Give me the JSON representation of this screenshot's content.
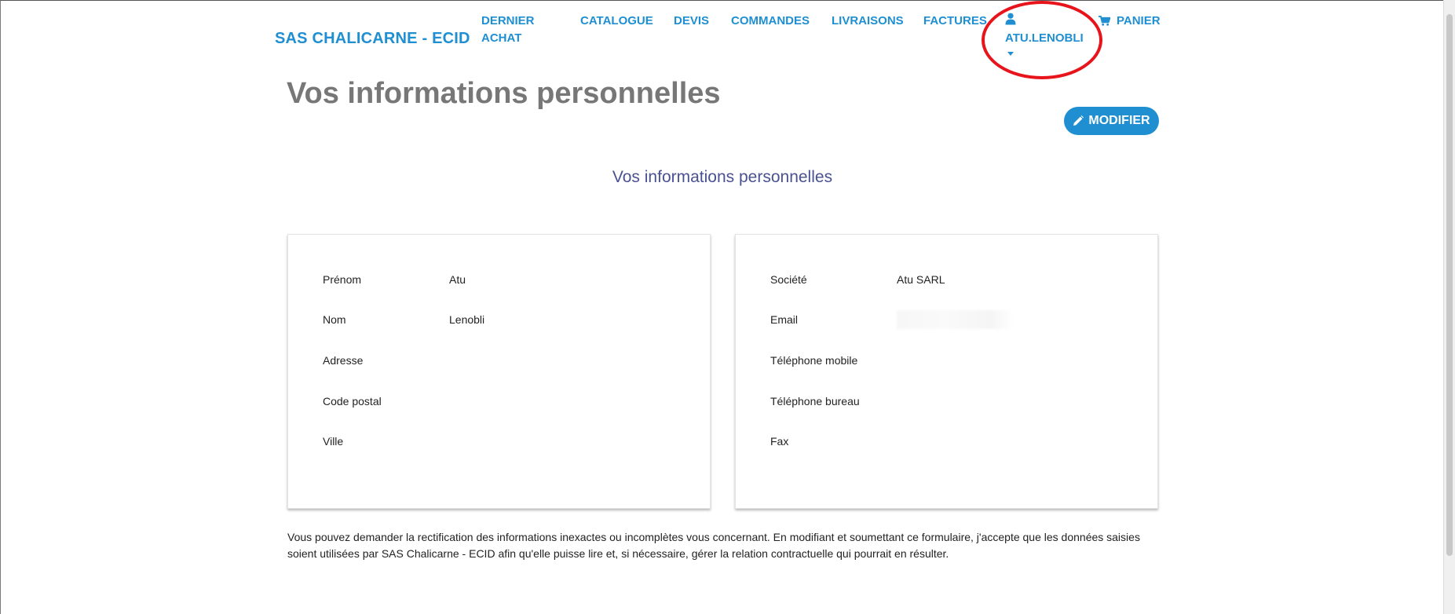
{
  "header": {
    "brand": "SAS CHALICARNE - ECID",
    "nav": {
      "dernier_achat": "DERNIER ACHAT",
      "catalogue": "CATALOGUE",
      "devis": "DEVIS",
      "commandes": "COMMANDES",
      "livraisons": "LIVRAISONS",
      "factures": "FACTURES",
      "user": "ATU.LENOBLI",
      "panier": "PANIER"
    },
    "accent_color": "#1f8fd1",
    "annotation_color": "#e8141b"
  },
  "page": {
    "title": "Vos informations personnelles",
    "modify_button": "MODIFIER",
    "subtitle": "Vos informations personnelles"
  },
  "personal": {
    "prenom": {
      "label": "Prénom",
      "value": "Atu"
    },
    "nom": {
      "label": "Nom",
      "value": "Lenobli"
    },
    "adresse": {
      "label": "Adresse",
      "value": ""
    },
    "code_postal": {
      "label": "Code postal",
      "value": ""
    },
    "ville": {
      "label": "Ville",
      "value": ""
    }
  },
  "company": {
    "societe": {
      "label": "Société",
      "value": "Atu SARL"
    },
    "email": {
      "label": "Email",
      "value": ""
    },
    "tel_mobile": {
      "label": "Téléphone mobile",
      "value": ""
    },
    "tel_bureau": {
      "label": "Téléphone bureau",
      "value": ""
    },
    "fax": {
      "label": "Fax",
      "value": ""
    }
  },
  "notice": "Vous pouvez demander la rectification des informations inexactes ou incomplètes vous concernant. En modifiant et soumettant ce formulaire, j'accepte que les données saisies soient utilisées par SAS Chalicarne - ECID afin qu'elle puisse lire et, si nécessaire, gérer la relation contractuelle qui pourrait en résulter."
}
